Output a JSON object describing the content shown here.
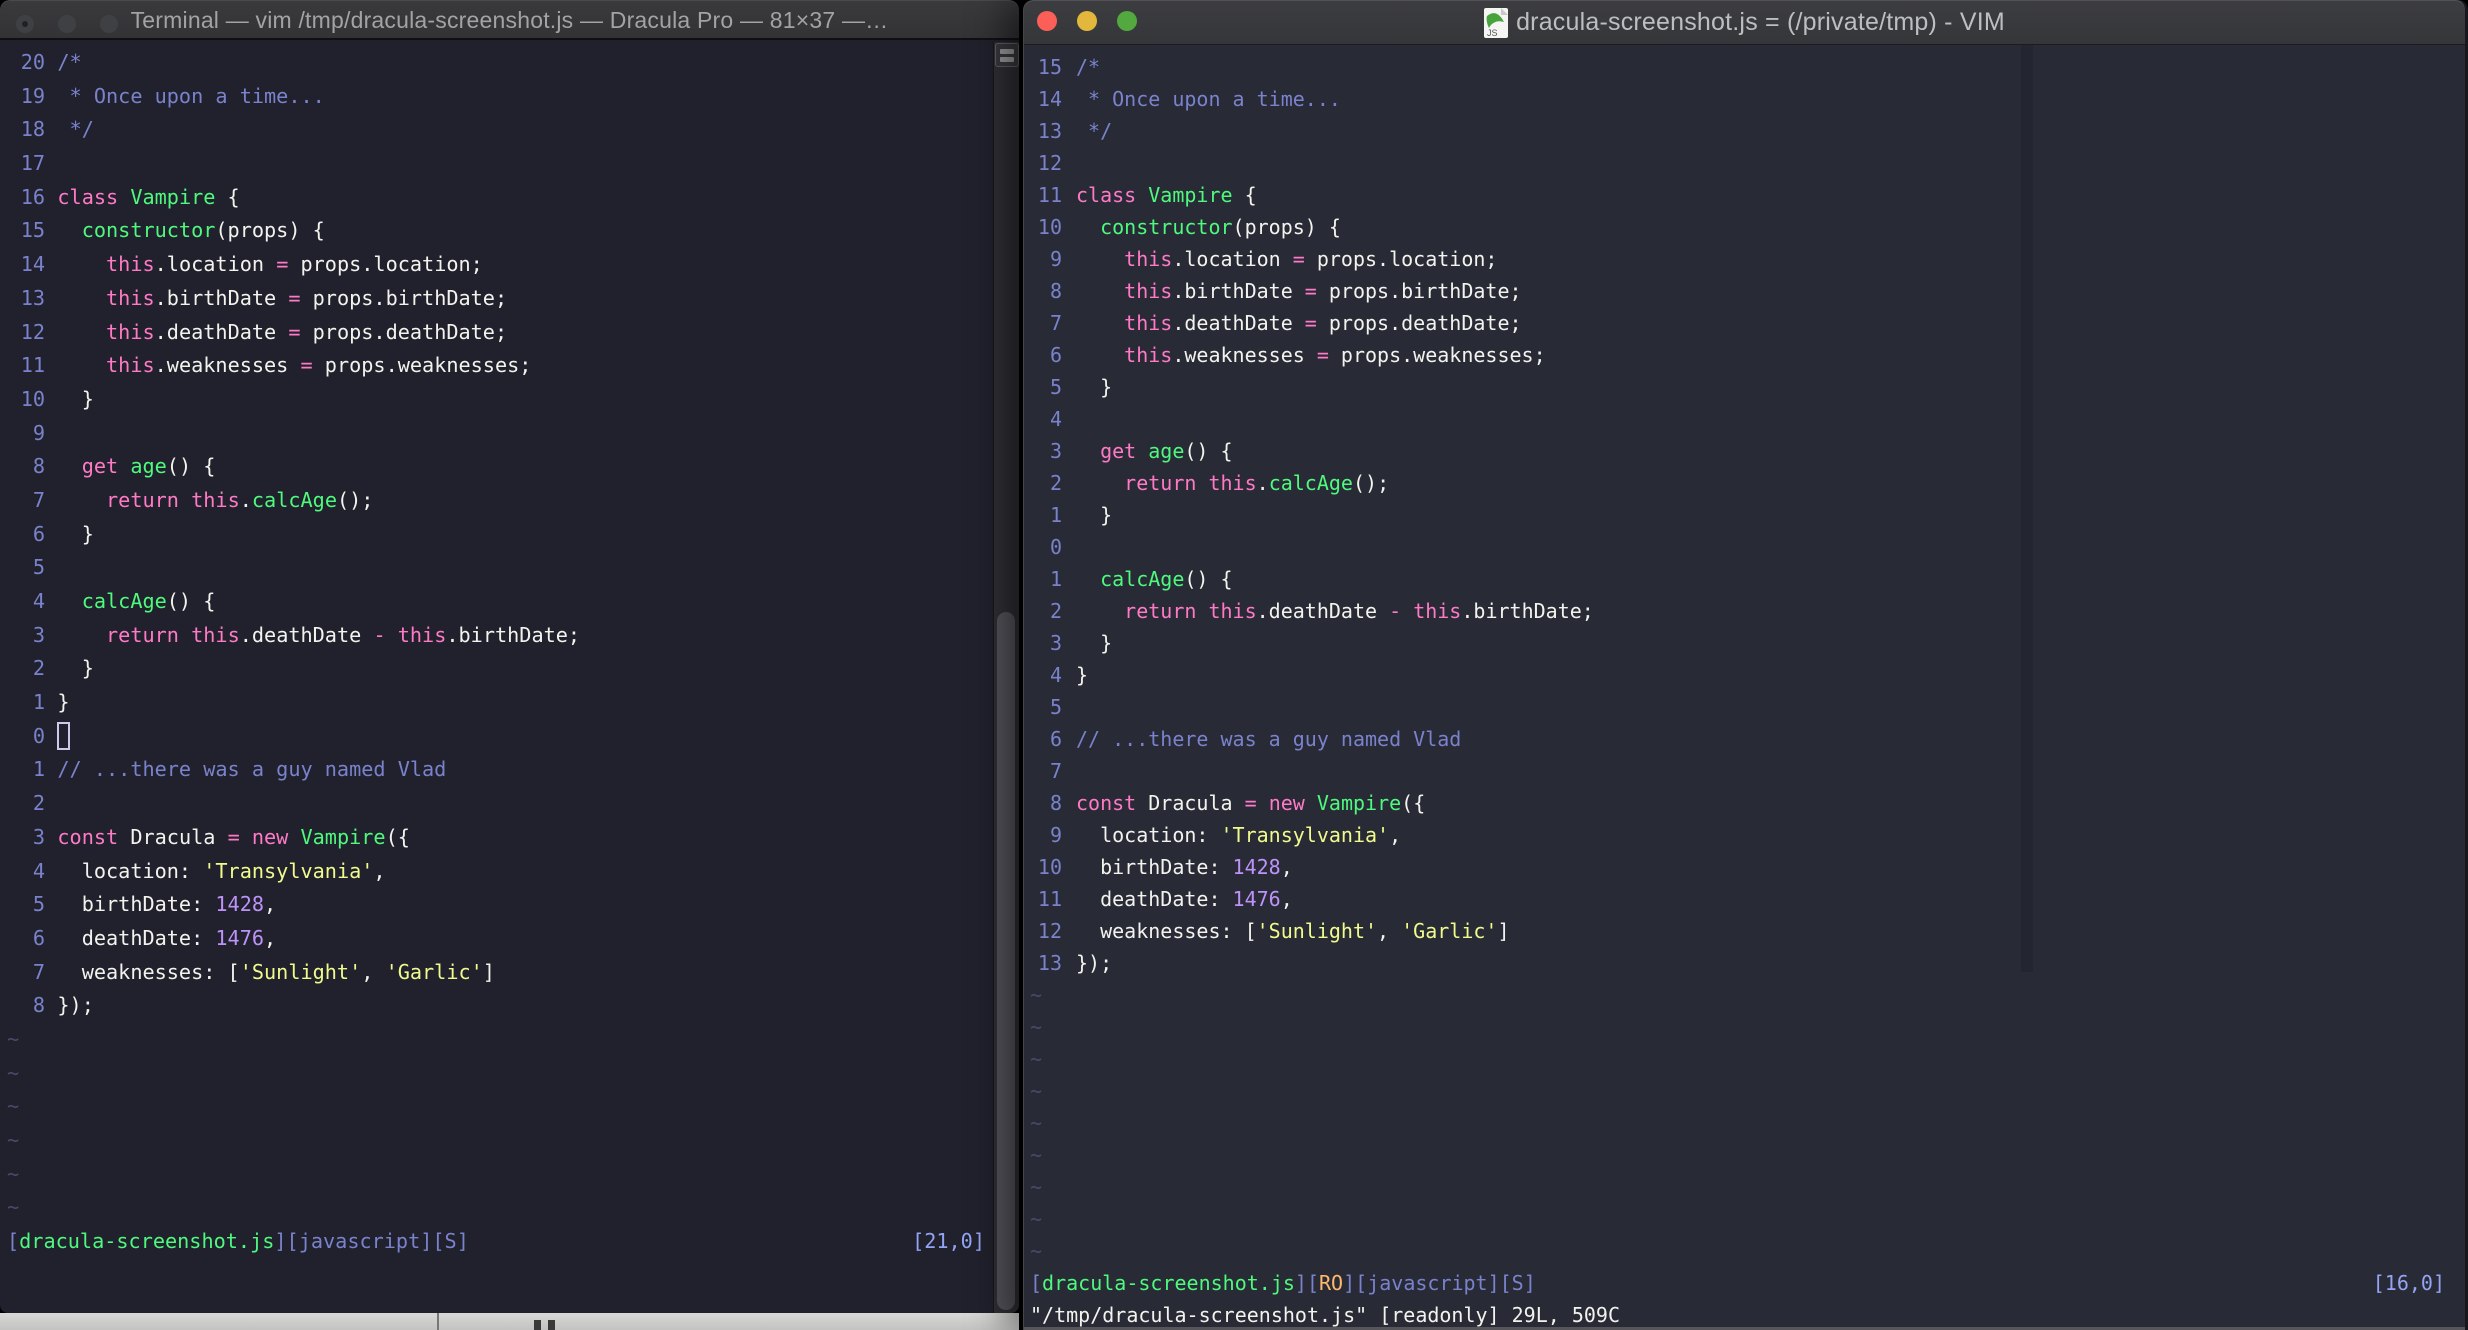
{
  "code_lines": [
    [
      [
        "v",
        "/*"
      ]
    ],
    [
      [
        "v",
        " * Once upon a time..."
      ]
    ],
    [
      [
        "v",
        " */"
      ]
    ],
    [],
    [
      [
        "p",
        "class"
      ],
      [
        "w",
        " "
      ],
      [
        "g",
        "Vampire"
      ],
      [
        "w",
        " {"
      ]
    ],
    [
      [
        "w",
        "  "
      ],
      [
        "g",
        "constructor"
      ],
      [
        "w",
        "(props) {"
      ]
    ],
    [
      [
        "w",
        "    "
      ],
      [
        "p",
        "this"
      ],
      [
        "w",
        ".location "
      ],
      [
        "p",
        "="
      ],
      [
        "w",
        " props.location;"
      ]
    ],
    [
      [
        "w",
        "    "
      ],
      [
        "p",
        "this"
      ],
      [
        "w",
        ".birthDate "
      ],
      [
        "p",
        "="
      ],
      [
        "w",
        " props.birthDate;"
      ]
    ],
    [
      [
        "w",
        "    "
      ],
      [
        "p",
        "this"
      ],
      [
        "w",
        ".deathDate "
      ],
      [
        "p",
        "="
      ],
      [
        "w",
        " props.deathDate;"
      ]
    ],
    [
      [
        "w",
        "    "
      ],
      [
        "p",
        "this"
      ],
      [
        "w",
        ".weaknesses "
      ],
      [
        "p",
        "="
      ],
      [
        "w",
        " props.weaknesses;"
      ]
    ],
    [
      [
        "w",
        "  }"
      ]
    ],
    [],
    [
      [
        "w",
        "  "
      ],
      [
        "p",
        "get"
      ],
      [
        "w",
        " "
      ],
      [
        "g",
        "age"
      ],
      [
        "w",
        "() {"
      ]
    ],
    [
      [
        "w",
        "    "
      ],
      [
        "p",
        "return"
      ],
      [
        "w",
        " "
      ],
      [
        "p",
        "this"
      ],
      [
        "w",
        "."
      ],
      [
        "g",
        "calcAge"
      ],
      [
        "w",
        "();"
      ]
    ],
    [
      [
        "w",
        "  }"
      ]
    ],
    [],
    [
      [
        "w",
        "  "
      ],
      [
        "g",
        "calcAge"
      ],
      [
        "w",
        "() {"
      ]
    ],
    [
      [
        "w",
        "    "
      ],
      [
        "p",
        "return"
      ],
      [
        "w",
        " "
      ],
      [
        "p",
        "this"
      ],
      [
        "w",
        ".deathDate "
      ],
      [
        "p",
        "-"
      ],
      [
        "w",
        " "
      ],
      [
        "p",
        "this"
      ],
      [
        "w",
        ".birthDate;"
      ]
    ],
    [
      [
        "w",
        "  }"
      ]
    ],
    [
      [
        "w",
        "}"
      ]
    ],
    [],
    [
      [
        "v",
        "// ...there was a guy named Vlad"
      ]
    ],
    [],
    [
      [
        "p",
        "const"
      ],
      [
        "w",
        " Dracula "
      ],
      [
        "p",
        "="
      ],
      [
        "w",
        " "
      ],
      [
        "p",
        "new"
      ],
      [
        "w",
        " "
      ],
      [
        "g",
        "Vampire"
      ],
      [
        "w",
        "({"
      ]
    ],
    [
      [
        "w",
        "  location: "
      ],
      [
        "y",
        "'Transylvania'"
      ],
      [
        "w",
        ","
      ]
    ],
    [
      [
        "w",
        "  birthDate: "
      ],
      [
        "pu",
        "1428"
      ],
      [
        "w",
        ","
      ]
    ],
    [
      [
        "w",
        "  deathDate: "
      ],
      [
        "pu",
        "1476"
      ],
      [
        "w",
        ","
      ]
    ],
    [
      [
        "w",
        "  weaknesses: ["
      ],
      [
        "y",
        "'Sunlight'"
      ],
      [
        "w",
        ", "
      ],
      [
        "y",
        "'Garlic'"
      ],
      [
        "w",
        "]"
      ]
    ],
    [
      [
        "w",
        "});"
      ]
    ]
  ],
  "left_window": {
    "title": "Terminal — vim /tmp/dracula-screenshot.js — Dracula Pro — 81×37 —…",
    "traffic_lights": [
      "close",
      "minimize",
      "zoom"
    ],
    "rel_numbers": [
      "20",
      "19",
      "18",
      "17",
      "16",
      "15",
      "14",
      "13",
      "12",
      "11",
      "10",
      "9",
      "8",
      "7",
      "6",
      "5",
      "4",
      "3",
      "2",
      "1",
      "0",
      "1",
      "2",
      "3",
      "4",
      "5",
      "6",
      "7",
      "8"
    ],
    "cursor_row": 20,
    "tilde_char": "~",
    "tilde_count": 6,
    "status": {
      "segments": [
        [
          "v",
          "["
        ],
        [
          "g",
          "dracula-screenshot.js"
        ],
        [
          "v",
          "][javascript][S]"
        ]
      ],
      "ruler": "[21,0]"
    },
    "command_line": ""
  },
  "right_window": {
    "title": "dracula-screenshot.js = (/private/tmp) - VIM",
    "traffic_lights": [
      "close",
      "minimize",
      "zoom"
    ],
    "rel_numbers": [
      "15",
      "14",
      "13",
      "12",
      "11",
      "10",
      "9",
      "8",
      "7",
      "6",
      "5",
      "4",
      "3",
      "2",
      "1",
      "0",
      "1",
      "2",
      "3",
      "4",
      "5",
      "6",
      "7",
      "8",
      "9",
      "10",
      "11",
      "12",
      "13"
    ],
    "cursor_row": null,
    "tilde_char": "~",
    "tilde_count": 9,
    "status": {
      "segments": [
        [
          "v",
          "["
        ],
        [
          "g",
          "dracula-screenshot.js"
        ],
        [
          "v",
          "]["
        ],
        [
          "o",
          "RO"
        ],
        [
          "v",
          "][javascript][S]"
        ]
      ],
      "ruler": "[16,0]"
    },
    "command_line": "\"/tmp/dracula-screenshot.js\" [readonly] 29L, 509C"
  }
}
